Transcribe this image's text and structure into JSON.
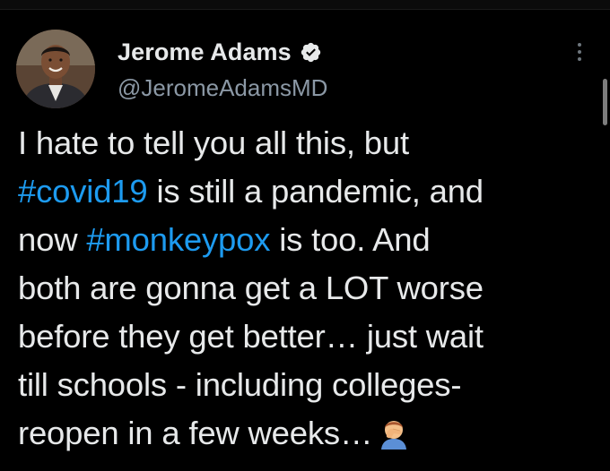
{
  "author": {
    "display_name": "Jerome Adams",
    "handle": "@JeromeAdamsMD",
    "verified": true,
    "avatar_icon": "avatar-photo"
  },
  "tweet": {
    "line1": "I hate to tell you all this, but",
    "hashtag1": "#covid19",
    "line2_rest": " is still a pandemic, and",
    "line3_start": "now ",
    "hashtag2": "#monkeypox",
    "line3_rest": " is too. And",
    "line4": "both are gonna get a LOT worse",
    "line5": "before they get better… just wait",
    "line6": "till schools - including colleges-",
    "line7": "reopen in a few weeks…",
    "emoji": "man-facepalming-emoji"
  },
  "colors": {
    "background": "#000000",
    "text": "#e7e9ea",
    "secondary": "#8b98a5",
    "link": "#1d9bf0"
  },
  "icons": {
    "verified": "verified-badge-icon",
    "more": "more-options-icon"
  }
}
